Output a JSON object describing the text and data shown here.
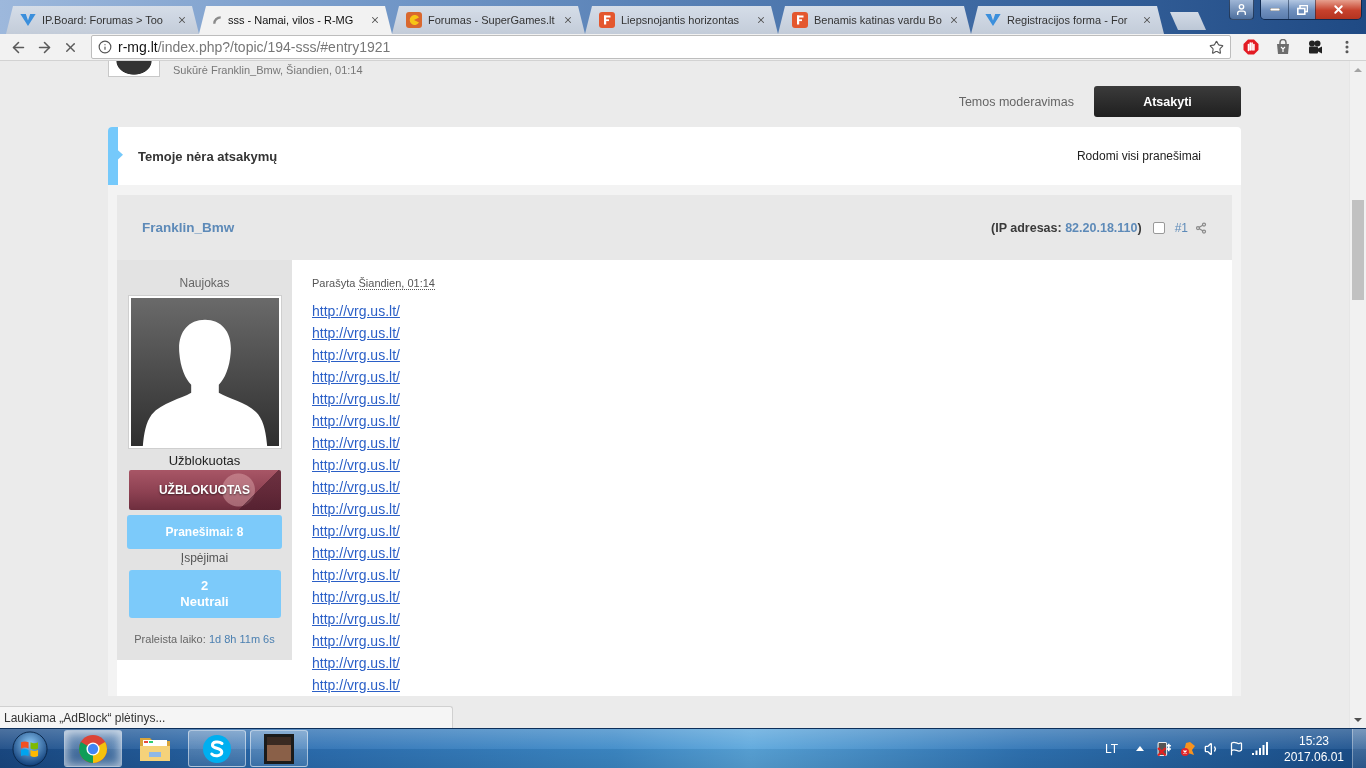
{
  "browser": {
    "tabs": [
      {
        "kind": "chevron",
        "title": "IP.Board: Forumas > Too",
        "selected": false
      },
      {
        "kind": "spinner",
        "title": "sss - Namai, vilos - R-MG",
        "selected": true
      },
      {
        "kind": "pacman",
        "title": "Forumas - SuperGames.lt",
        "selected": false
      },
      {
        "kind": "letter",
        "title": "Liepsnojantis horizontas",
        "selected": false
      },
      {
        "kind": "letter",
        "title": "Benamis katinas vardu Bo",
        "selected": false
      },
      {
        "kind": "chevron",
        "title": "Registracijos forma - For",
        "selected": false
      }
    ],
    "address": {
      "host": "r-mg.lt",
      "path": "/index.php?/topic/194-sss/#entry1921"
    },
    "status_bubble": "Laukiama „AdBlock“ plėtinys..."
  },
  "topic": {
    "meta": "Sukūrė Franklin_Bmw, Šiandien, 01:14",
    "moderation": "Temos moderavimas",
    "reply_button": "Atsakyti",
    "replies_status": "Temoje nėra atsakymų",
    "filter": "Rodomi visi pranešimai"
  },
  "post": {
    "author": "Franklin_Bmw",
    "ip_prefix": "(IP adresas:",
    "ip": "82.20.18.110",
    "ip_suffix": ")",
    "checked": false,
    "number": "#1",
    "rank": "Naujokas",
    "group": "Užblokuotas",
    "banner": "UŽBLOKUOTAS",
    "posts": "Pranešimai: 8",
    "warnings_label": "Įspėjimai",
    "warnings_count": "2",
    "warnings_status": "Neutrali",
    "time_label": "Praleista laiko:",
    "time_value": "1d 8h 11m 6s",
    "posted_label": "Parašyta",
    "posted_time": "Šiandien, 01:14",
    "links": [
      "http://vrg.us.lt/",
      "http://vrg.us.lt/",
      "http://vrg.us.lt/",
      "http://vrg.us.lt/",
      "http://vrg.us.lt/",
      "http://vrg.us.lt/",
      "http://vrg.us.lt/",
      "http://vrg.us.lt/",
      "http://vrg.us.lt/",
      "http://vrg.us.lt/",
      "http://vrg.us.lt/",
      "http://vrg.us.lt/",
      "http://vrg.us.lt/",
      "http://vrg.us.lt/",
      "http://vrg.us.lt/",
      "http://vrg.us.lt/",
      "http://vrg.us.lt/",
      "http://vrg.us.lt/"
    ]
  },
  "taskbar": {
    "apps": [
      {
        "kind": "chrome",
        "running": true,
        "selected": true
      },
      {
        "kind": "explorer",
        "running": false,
        "selected": false
      },
      {
        "kind": "skype",
        "running": true,
        "selected": false
      },
      {
        "kind": "game",
        "running": true,
        "selected": false
      }
    ],
    "language": "LT",
    "time": "15:23",
    "date": "2017.06.01"
  }
}
